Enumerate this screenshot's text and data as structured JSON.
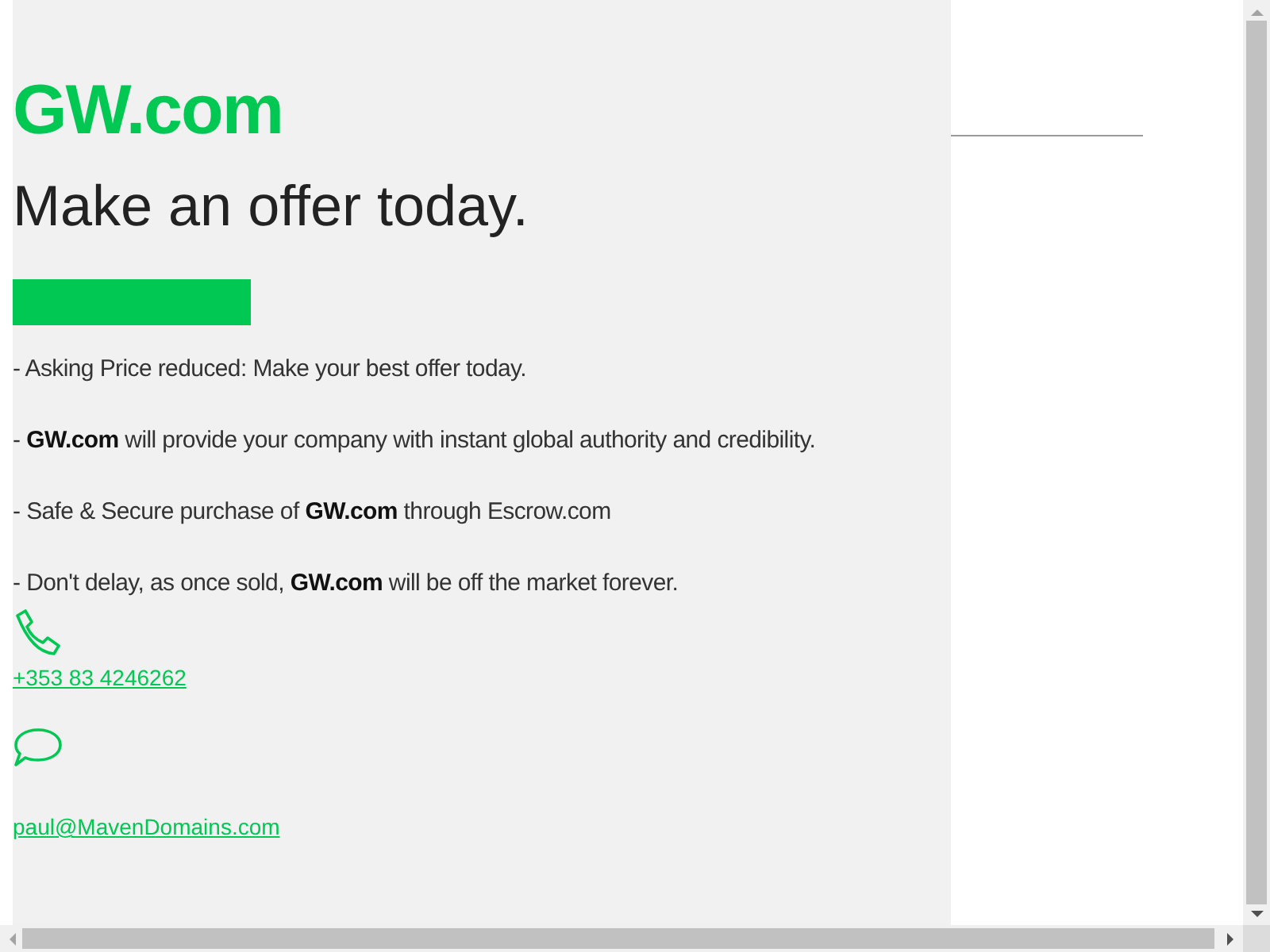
{
  "logo": "GW.com",
  "headline": "Make an offer today.",
  "points": [
    "- Asking Price reduced: Make your best offer today.",
    "- **GW.com** will provide your company with instant global authority and credibility.",
    "- Safe & Secure purchase of **GW.com** through Escrow.com",
    "- Don't delay, as once sold, **GW.com** will be off the market forever."
  ],
  "contacts": [
    {
      "kind": "phone",
      "text": "+353 83 4246262"
    },
    {
      "kind": "chat",
      "text": "paul@MavenDomains.com"
    }
  ]
}
